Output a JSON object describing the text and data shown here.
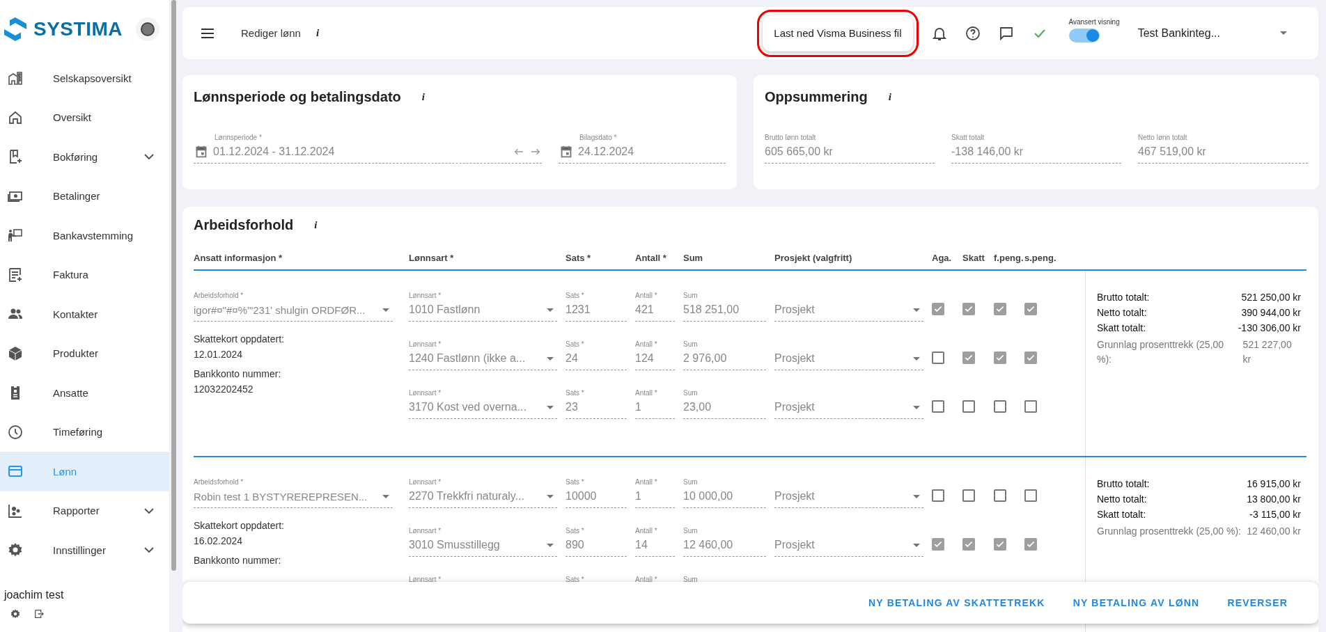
{
  "sidebar": {
    "logo": "SYSTIMA",
    "items": [
      {
        "label": "Selskapsoversikt",
        "expandable": false,
        "selected": false
      },
      {
        "label": "Oversikt",
        "expandable": false,
        "selected": false
      },
      {
        "label": "Bokføring",
        "expandable": true,
        "selected": false
      },
      {
        "label": "Betalinger",
        "expandable": false,
        "selected": false
      },
      {
        "label": "Bankavstemming",
        "expandable": false,
        "selected": false
      },
      {
        "label": "Faktura",
        "expandable": false,
        "selected": false
      },
      {
        "label": "Kontakter",
        "expandable": false,
        "selected": false
      },
      {
        "label": "Produkter",
        "expandable": false,
        "selected": false
      },
      {
        "label": "Ansatte",
        "expandable": false,
        "selected": false
      },
      {
        "label": "Timeføring",
        "expandable": false,
        "selected": false
      },
      {
        "label": "Lønn",
        "expandable": false,
        "selected": true
      },
      {
        "label": "Rapporter",
        "expandable": true,
        "selected": false
      },
      {
        "label": "Innstillinger",
        "expandable": true,
        "selected": false
      }
    ],
    "user": "joachim test"
  },
  "topbar": {
    "title": "Rediger lønn",
    "info": "i",
    "download_button": {
      "label": "Last ned Visma Business fil",
      "highlighted": true
    },
    "advanced_view": {
      "label": "Avansert visning",
      "on": true
    },
    "company": "Test Bankinteg..."
  },
  "period_card": {
    "title": "Lønnsperiode og betalingsdato",
    "info": "i",
    "period": {
      "label": "Lønnsperiode *",
      "value": "01.12.2024 - 31.12.2024"
    },
    "voucher_date": {
      "label": "Bilagsdato *",
      "value": "24.12.2024"
    }
  },
  "summary_card": {
    "title": "Oppsummering",
    "info": "i",
    "fields": [
      {
        "label": "Brutto lønn totalt",
        "value": "605 665,00 kr"
      },
      {
        "label": "Skatt totalt",
        "value": "-138 146,00 kr"
      },
      {
        "label": "Netto lønn totalt",
        "value": "467 519,00 kr"
      }
    ]
  },
  "employment_card": {
    "title": "Arbeidsforhold",
    "info": "i",
    "columns": [
      "Ansatt informasjon *",
      "Lønnsart *",
      "Sats *",
      "Antall *",
      "Sum",
      "Prosjekt (valgfritt)",
      "Aga.",
      "Skatt",
      "f.peng.",
      "s.peng."
    ],
    "employees": [
      {
        "employment": {
          "label": "Arbeidsforhold *",
          "value": "igor#¤\"#¤%'\"231' shulgin ORDFØR..."
        },
        "info": [
          {
            "label": "Skattekort oppdatert:",
            "value": "12.01.2024"
          },
          {
            "label": "Bankkonto nummer:",
            "value": "12032202452"
          }
        ],
        "lines": [
          {
            "type": {
              "label": "Lønnsart *",
              "value": "1010 Fastlønn"
            },
            "rate": {
              "label": "Sats *",
              "value": "1231"
            },
            "qty": {
              "label": "Antall *",
              "value": "421"
            },
            "sum": {
              "label": "Sum",
              "value": "518 251,00"
            },
            "project": {
              "placeholder": "Prosjekt"
            },
            "checks": [
              {
                "checked": true
              },
              {
                "checked": true
              },
              {
                "checked": true
              },
              {
                "checked": true
              }
            ]
          },
          {
            "type": {
              "label": "Lønnsart *",
              "value": "1240 Fastlønn (ikke a..."
            },
            "rate": {
              "label": "Sats *",
              "value": "24"
            },
            "qty": {
              "label": "Antall *",
              "value": "124"
            },
            "sum": {
              "label": "Sum",
              "value": "2 976,00"
            },
            "project": {
              "placeholder": "Prosjekt"
            },
            "checks": [
              {
                "checked": false
              },
              {
                "checked": true
              },
              {
                "checked": true
              },
              {
                "checked": true
              }
            ]
          },
          {
            "type": {
              "label": "Lønnsart *",
              "value": "3170 Kost ved overna..."
            },
            "rate": {
              "label": "Sats *",
              "value": "23"
            },
            "qty": {
              "label": "Antall *",
              "value": "1"
            },
            "sum": {
              "label": "Sum",
              "value": "23,00"
            },
            "project": {
              "placeholder": "Prosjekt"
            },
            "checks": [
              {
                "checked": false
              },
              {
                "checked": false
              },
              {
                "checked": false
              },
              {
                "checked": false
              }
            ]
          }
        ],
        "totals": [
          {
            "label": "Brutto totalt:",
            "value": "521 250,00 kr",
            "kind": "main"
          },
          {
            "label": "Netto totalt:",
            "value": "390 944,00 kr",
            "kind": "main"
          },
          {
            "label": "Skatt totalt:",
            "value": "-130 306,00 kr",
            "kind": "main"
          },
          {
            "label": "Grunnlag prosenttrekk (25,00 %):",
            "value": "521 227,00 kr",
            "kind": "basis"
          }
        ]
      },
      {
        "employment": {
          "label": "Arbeidsforhold *",
          "value": "Robin test 1 BYSTYREREPRESEN..."
        },
        "info": [
          {
            "label": "Skattekort oppdatert:",
            "value": "16.02.2024"
          },
          {
            "label": "Bankkonto nummer:"
          }
        ],
        "lines": [
          {
            "type": {
              "label": "Lønnsart *",
              "value": "2270 Trekkfri naturaly..."
            },
            "rate": {
              "label": "Sats *",
              "value": "10000"
            },
            "qty": {
              "label": "Antall *",
              "value": "1"
            },
            "sum": {
              "label": "Sum",
              "value": "10 000,00"
            },
            "project": {
              "placeholder": "Prosjekt"
            },
            "checks": [
              {
                "checked": false
              },
              {
                "checked": false
              },
              {
                "checked": false
              },
              {
                "checked": false
              }
            ]
          },
          {
            "type": {
              "label": "Lønnsart *",
              "value": "3010 Smusstillegg"
            },
            "rate": {
              "label": "Sats *",
              "value": "890"
            },
            "qty": {
              "label": "Antall *",
              "value": "14"
            },
            "sum": {
              "label": "Sum",
              "value": "12 460,00"
            },
            "project": {
              "placeholder": "Prosjekt"
            },
            "checks": [
              {
                "checked": true
              },
              {
                "checked": true
              },
              {
                "checked": true
              },
              {
                "checked": true
              }
            ]
          },
          {
            "type": {
              "label": "Lønnsart *"
            },
            "rate": {
              "label": "Sats *"
            },
            "qty": {
              "label": "Antall *"
            },
            "sum": {
              "label": "Sum"
            }
          }
        ],
        "totals": [
          {
            "label": "Brutto totalt:",
            "value": "16 915,00 kr",
            "kind": "main"
          },
          {
            "label": "Netto totalt:",
            "value": "13 800,00 kr",
            "kind": "main"
          },
          {
            "label": "Skatt totalt:",
            "value": "-3 115,00 kr",
            "kind": "main"
          },
          {
            "label": "Grunnlag prosenttrekk (25,00 %):",
            "value": "12 460,00 kr",
            "kind": "basis"
          }
        ]
      }
    ]
  },
  "footer_buttons": [
    "NY BETALING AV SKATTETREKK",
    "NY BETALING AV LØNN",
    "REVERSER"
  ]
}
